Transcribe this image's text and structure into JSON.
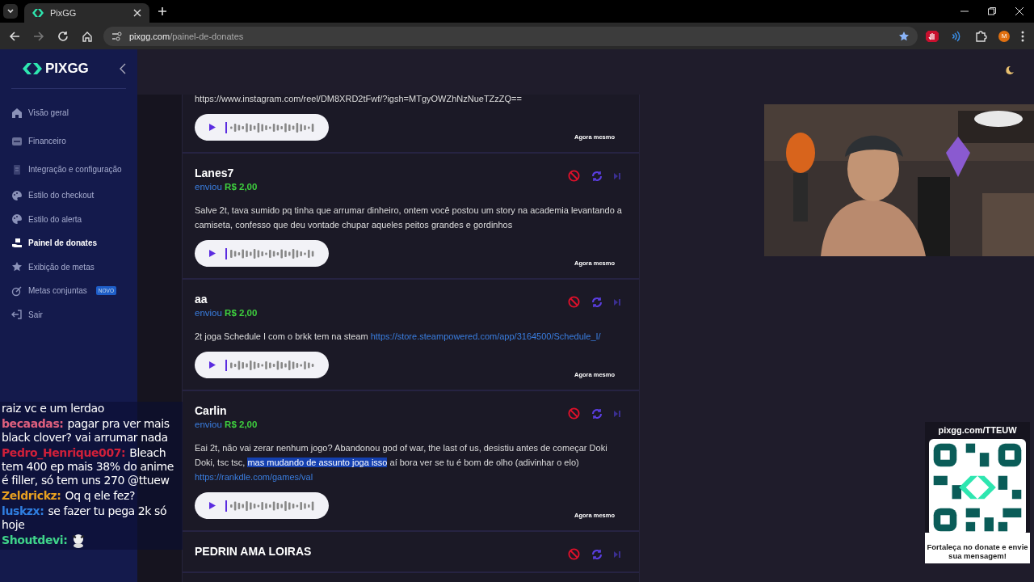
{
  "browser": {
    "tab_title": "PixGG",
    "url_host": "pixgg.com",
    "url_path": "/painel-de-donates",
    "profile_initial": "M"
  },
  "sidebar": {
    "logo": "PIXGG",
    "items": [
      {
        "label": "Visão geral",
        "kind": "home",
        "selected": false
      },
      {
        "label": "Financeiro",
        "kind": "wallet",
        "selected": false
      },
      {
        "label": "Integração e configuração",
        "kind": "doc",
        "selected": false
      },
      {
        "label": "Estilo do checkout",
        "kind": "palette",
        "selected": false
      },
      {
        "label": "Estilo do alerta",
        "kind": "palette",
        "selected": false
      },
      {
        "label": "Painel de donates",
        "kind": "hand",
        "selected": true
      },
      {
        "label": "Exibição de metas",
        "kind": "star",
        "selected": false
      },
      {
        "label": "Metas conjuntas",
        "kind": "target",
        "selected": false,
        "badge": "NOVO"
      },
      {
        "label": "Sair",
        "kind": "exit",
        "selected": false
      }
    ]
  },
  "donates": [
    {
      "message": [
        {
          "kind": "text",
          "text": "https://www.instagram.com/reel/DM8XRD2tFwf/?igsh=MTgyOWZhNzNueTZzZQ=="
        }
      ],
      "time": "Agora mesmo"
    },
    {
      "name": "Lanes7",
      "verb": "enviou",
      "amount": "R$ 2,00",
      "message": [
        {
          "kind": "text",
          "text": "Salve 2t, tava sumido pq tinha que arrumar dinheiro, ontem você postou um story na academia levantando a camiseta, confesso que deu vontade chupar aqueles peitos grandes e gordinhos"
        }
      ],
      "time": "Agora mesmo"
    },
    {
      "name": "aa",
      "verb": "enviou",
      "amount": "R$ 2,00",
      "message": [
        {
          "kind": "text",
          "text": "2t joga Schedule I com o brkk tem na steam "
        },
        {
          "kind": "link",
          "text": "https://store.steampowered.com/app/3164500/Schedule_I/"
        }
      ],
      "time": "Agora mesmo"
    },
    {
      "name": "Carlin",
      "verb": "enviou",
      "amount": "R$ 2,00",
      "message": [
        {
          "kind": "text",
          "text": "Eai 2t, não vai zerar nenhum jogo? Abandonou god of war, the last of us, desistiu antes de começar Doki Doki, tsc tsc, "
        },
        {
          "kind": "selected",
          "text": "mas mudando de assunto joga isso"
        },
        {
          "kind": "text",
          "text": " aí bora ver se tu é bom de olho (adivinhar o elo) "
        },
        {
          "kind": "link",
          "text": "https://rankdle.com/games/val"
        }
      ],
      "time": "Agora mesmo"
    },
    {
      "name": "PEDRIN AMA LOIRAS"
    }
  ],
  "chat": [
    {
      "text": "raiz vc e um lerdao"
    },
    {
      "user": "becaadas:",
      "color": "#e0607e",
      "text": "pagar pra ver mais black clover? vai arrumar nada"
    },
    {
      "user": "Pedro_Henrique007:",
      "color": "#d0203a",
      "text": "Bleach tem 400 ep mais 38% do anime é filler, só tem uns 270 @ttuew"
    },
    {
      "user": "Zeldrickz:",
      "color": "#e8a020",
      "text": "Oq q ele fez?"
    },
    {
      "user": "luskzx:",
      "color": "#2f7ee0",
      "text": "se fazer tu pega 2k só hoje"
    },
    {
      "user": "Shoutdevi:",
      "color": "#3fd48a",
      "emote": true
    }
  ],
  "qr_widget": {
    "url": "pixgg.com/TTEUW",
    "caption": "Fortaleça no donate e envie sua mensagem!"
  }
}
